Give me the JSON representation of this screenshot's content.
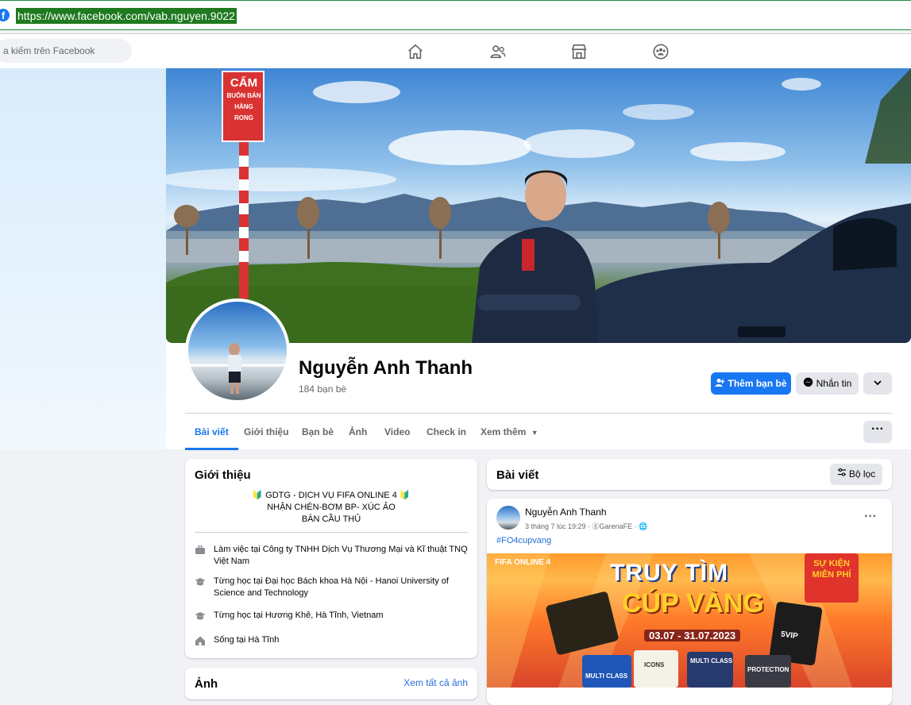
{
  "browser": {
    "url": "https://www.facebook.com/vab.nguyen.9022"
  },
  "nav": {
    "search_placeholder": "a kiếm trên Facebook"
  },
  "profile": {
    "name": "Nguyễn Anh Thanh",
    "friends": "184 bạn bè",
    "buttons": {
      "add_friend": "Thêm bạn bè",
      "message": "Nhắn tin"
    }
  },
  "cover_sign": {
    "line1": "CẤM",
    "line2": "BUÔN BÁN",
    "line3": "HÀNG RONG"
  },
  "tabs": [
    {
      "label": "Bài viết"
    },
    {
      "label": "Giới thiệu"
    },
    {
      "label": "Bạn bè"
    },
    {
      "label": "Ảnh"
    },
    {
      "label": "Video"
    },
    {
      "label": "Check in"
    },
    {
      "label": "Xem thêm"
    }
  ],
  "intro": {
    "title": "Giới thiệu",
    "bio": [
      "🔰 GDTG - DỊCH VỤ FIFA ONLINE 4 🔰",
      "NHẬN CHÉN-BƠM BP- XÚC ẢO",
      "BÁN CẦU THỦ"
    ],
    "items": [
      {
        "icon": "briefcase-icon",
        "prefix": "Làm việc tại ",
        "value": "Công ty TNHH Dịch Vụ Thương Mại và Kĩ thuật TNQ Việt Nam"
      },
      {
        "icon": "graduation-cap-icon",
        "prefix": "Từng học tại ",
        "value": "Đại học Bách khoa Hà Nội - Hanoi University of Science and Technology"
      },
      {
        "icon": "graduation-cap-icon",
        "prefix": "Từng học tại Hương Khê, Hà Tĩnh, Vietnam",
        "value": ""
      },
      {
        "icon": "home-icon",
        "prefix": "Sống tại ",
        "value": "Hà Tĩnh"
      }
    ]
  },
  "photos": {
    "title": "Ảnh",
    "see_all": "Xem tất cả ảnh"
  },
  "posts": {
    "title": "Bài viết",
    "filter": "Bộ lọc",
    "post": {
      "author": "Nguyễn Anh Thanh",
      "meta": "3 tháng 7 lúc 19:29 · ⓖGarenaFE · 🌐",
      "hashtag": "#FO4cupvang",
      "image": {
        "brand": "FIFA ONLINE 4",
        "headline1": "TRUY TÌM",
        "headline2": "CÚP VÀNG",
        "dates": "03.07 - 31.07.2023",
        "badge1": "SỰ KIỆN",
        "badge2": "MIỄN PHÍ",
        "cards": [
          "MULTI CLASS",
          "ICONS",
          "MULTI CLASS",
          "PROTECTION"
        ],
        "card_extra": "5VIP"
      }
    }
  },
  "colors": {
    "brand": "#1877f2",
    "text_secondary": "#65676b",
    "page_bg": "#f0f2f5"
  }
}
